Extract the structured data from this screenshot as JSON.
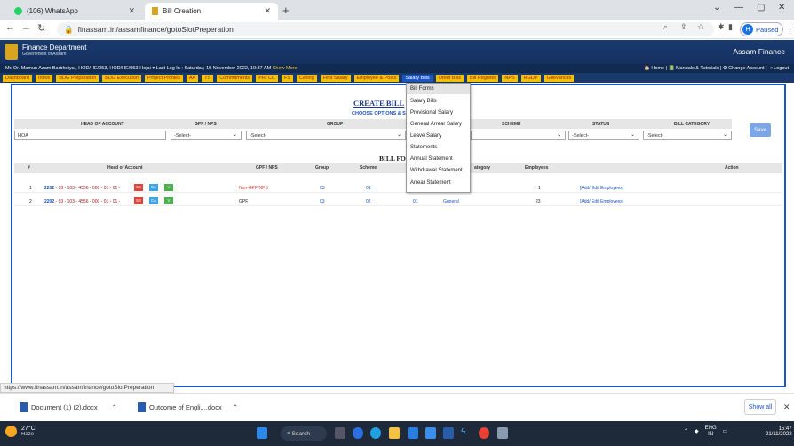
{
  "browser": {
    "tabs": [
      {
        "label": "(106) WhatsApp"
      },
      {
        "label": "Bill Creation"
      }
    ],
    "url": "finassam.in/assamfinance/gotoSlotPreperation",
    "profile_status": "Paused",
    "profile_initial": "H"
  },
  "site": {
    "dept": "Finance Department",
    "gov": "Government of Assam",
    "brand": "Assam Finance",
    "user_line": "Mr. Dr. Mamun Azam Barbhuiya , HOD/HE/053, HOD/HE/053-Hojai ▾  Last Log In : Saturday, 19 November 2022, 10:37 AM",
    "show_more": "Show More",
    "right_links": "🏠 Home | 📗 Manuals & Tutorials | ⚙ Change Account | ⇥ Logout"
  },
  "menu": [
    "Dashboard",
    "Inbox",
    "BDG Preparation",
    "BDG Execution",
    "Project Profiles",
    "AA",
    "TS",
    "Commitments",
    "PR/ CC",
    "FS",
    "Ceiling",
    "First Salary",
    "Employee & Posts",
    "Salary Bills",
    "Other Bills",
    "Bill Register",
    "NPS",
    "RGDP",
    "Grievances"
  ],
  "submenu": [
    "Bill Forms",
    "Salary Bills",
    "Provisional Salary",
    "General Arrear Salary",
    "Leave Salary",
    "Statements",
    "Annual Statement",
    "Withdrawal Statement",
    "Arrear Statemen"
  ],
  "dropdown": [
    "Bill Forms",
    "Salary Bills",
    "Provisional Salary",
    "General Arrear Salary",
    "Leave Salary",
    "Statements",
    "Annual Statement",
    "Withdrawal Statement",
    "Arrear Statement"
  ],
  "form": {
    "title": "CREATE BILL",
    "choose": "CHOOSE OPTIONS & S",
    "headers": {
      "hoa": "HEAD OF ACCOUNT",
      "gpf": "GPF / NPS",
      "group": "GROUP",
      "scheme": "SCHEME",
      "status": "STATUS",
      "category": "BILL CATEGORY"
    },
    "hoa_value": "HOA",
    "select": "-Select-",
    "save": "Save"
  },
  "table": {
    "title": "BILL FO",
    "headers": {
      "num": "#",
      "hoa": "Head of Account",
      "gpf": "GPF / NPS",
      "group": "Group",
      "scheme": "Scheme",
      "category": "ategory",
      "employees": "Employees",
      "action": "Action"
    },
    "rows": [
      {
        "num": "1",
        "hoa_code": "2202",
        "hoa_rest": " - 03 - 103 - 4556 - 000 - 01 - 01 -",
        "badges": [
          "SE",
          "CA",
          "V"
        ],
        "gpf": "Non-GPF/NPS",
        "group": "03",
        "scheme": "01",
        "category": "",
        "employees": "1",
        "action": "[Add/ Edit Employees]"
      },
      {
        "num": "2",
        "hoa_code": "2202",
        "hoa_rest": " - 03 - 103 - 4556 - 000 - 01 - 01 -",
        "badges": [
          "SE",
          "CA",
          "V"
        ],
        "gpf": "GPF",
        "group": "03",
        "scheme": "02",
        "scheme_id": "01",
        "category": "General",
        "employees": "23",
        "action": "[Add/ Edit Employees]"
      }
    ]
  },
  "status_url": "https://www.finassam.in/assamfinance/gotoSlotPreperation",
  "downloads": [
    {
      "name": "Document (1) (2).docx"
    },
    {
      "name": "Outcome of Engli....docx"
    }
  ],
  "show_all": "Show all",
  "taskbar": {
    "temp": "27°C",
    "weather": "Haze",
    "search": "Search",
    "lang": "ENG",
    "region": "IN",
    "time": "15:47",
    "date": "21/11/2022"
  }
}
